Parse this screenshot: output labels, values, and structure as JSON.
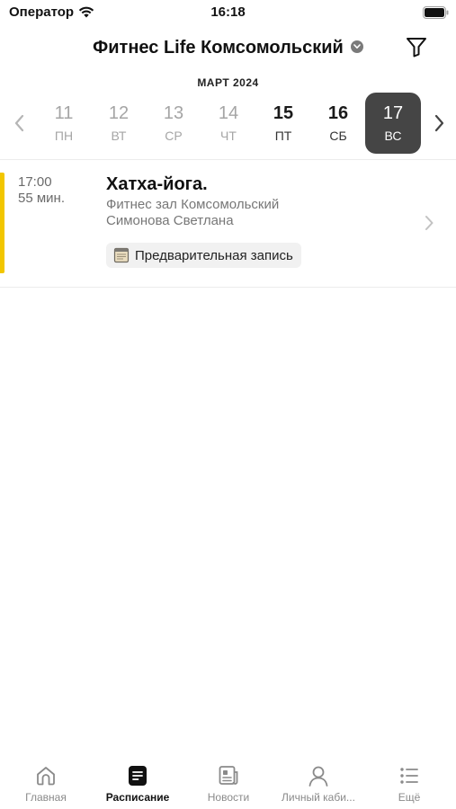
{
  "status_bar": {
    "carrier": "Оператор",
    "time": "16:18"
  },
  "header": {
    "title": "Фитнес Life Комсомольский"
  },
  "calendar": {
    "month": "МАРТ 2024",
    "days": [
      {
        "num": "11",
        "name": "ПН",
        "state": "muted"
      },
      {
        "num": "12",
        "name": "ВТ",
        "state": "muted"
      },
      {
        "num": "13",
        "name": "СР",
        "state": "muted"
      },
      {
        "num": "14",
        "name": "ЧТ",
        "state": "muted"
      },
      {
        "num": "15",
        "name": "ПТ",
        "state": "normal"
      },
      {
        "num": "16",
        "name": "СБ",
        "state": "normal"
      },
      {
        "num": "17",
        "name": "ВС",
        "state": "selected"
      }
    ]
  },
  "event": {
    "time": "17:00",
    "duration": "55 мин.",
    "title": "Хатха-йога.",
    "venue": "Фитнес зал Комсомольский",
    "trainer": "Симонова Светлана",
    "badge": "Предварительная запись",
    "accent_color": "#f2c600"
  },
  "tabs": [
    {
      "label": "Главная",
      "icon": "home-icon",
      "active": false
    },
    {
      "label": "Расписание",
      "icon": "schedule-icon",
      "active": true
    },
    {
      "label": "Новости",
      "icon": "news-icon",
      "active": false
    },
    {
      "label": "Личный каби...",
      "icon": "profile-icon",
      "active": false
    },
    {
      "label": "Ещё",
      "icon": "more-list-icon",
      "active": false
    }
  ]
}
